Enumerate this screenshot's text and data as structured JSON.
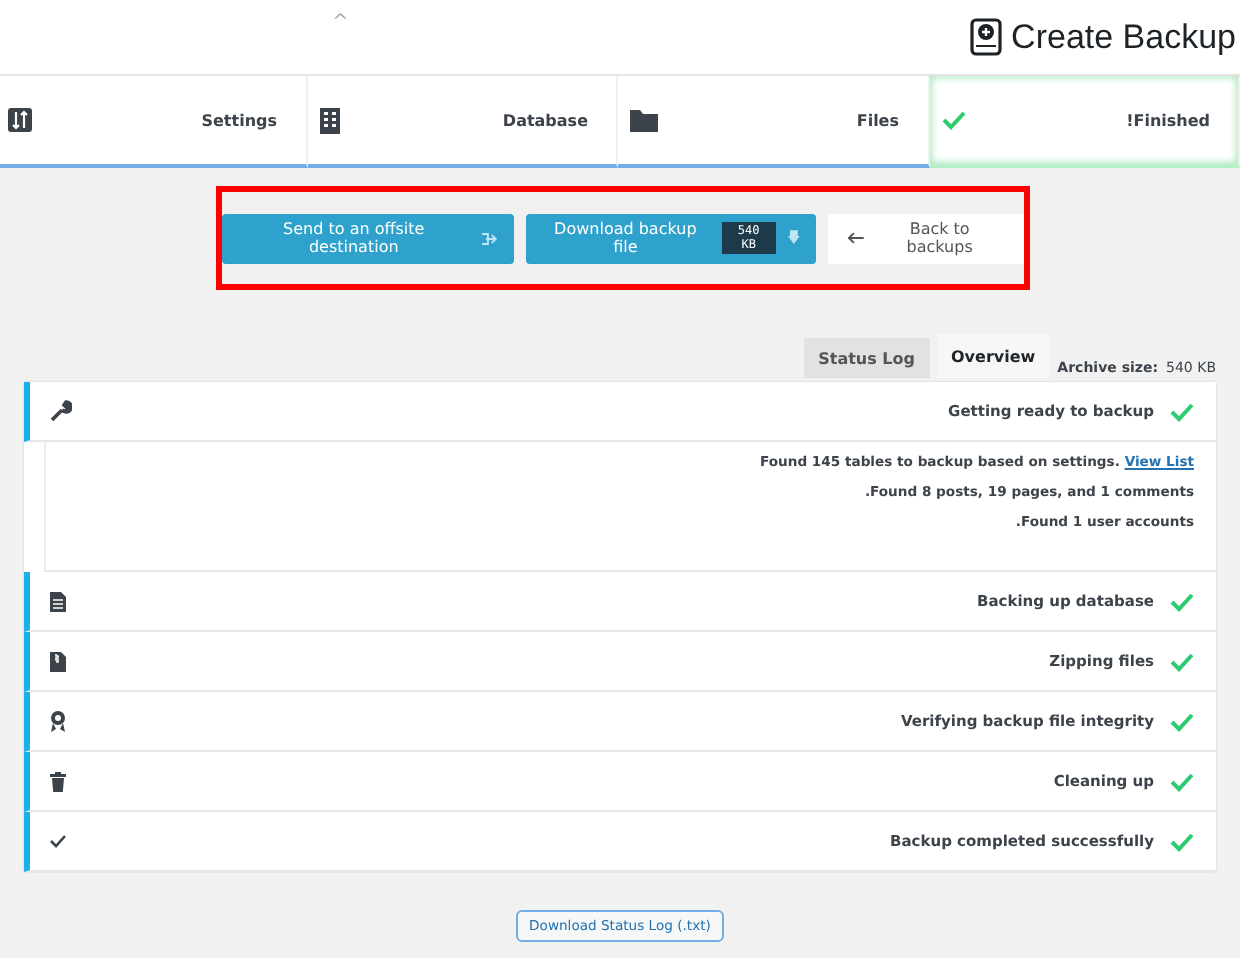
{
  "header": {
    "collapse_glyph": "^",
    "title": "Create Backup"
  },
  "steps": [
    {
      "label": "Settings",
      "selected": false
    },
    {
      "label": "Database",
      "selected": false
    },
    {
      "label": "Files",
      "selected": false
    },
    {
      "label": "!Finished",
      "selected": true
    }
  ],
  "actions": {
    "offsite": "Send to an offsite destination",
    "download": "Download backup file",
    "download_size": "540 KB",
    "back": "Back to backups"
  },
  "tabs": [
    {
      "label": "Status Log",
      "selected": false
    },
    {
      "label": "Overview",
      "selected": true
    }
  ],
  "archive_size": {
    "label": "Archive size:",
    "value": "540 KB"
  },
  "log": [
    {
      "text": "Getting ready to backup",
      "done": true,
      "details": [
        {
          "text": "Found 145 tables to backup based on settings.",
          "link": "View List"
        },
        {
          "text": ".Found 8 posts, 19 pages, and 1 comments"
        },
        {
          "text": ".Found 1 user accounts"
        }
      ]
    },
    {
      "text": "Backing up database",
      "done": true
    },
    {
      "text": "Zipping files",
      "done": true
    },
    {
      "text": "Verifying backup file integrity",
      "done": true
    },
    {
      "text": "Cleaning up",
      "done": true
    },
    {
      "text": "Backup completed successfully",
      "done": true
    }
  ],
  "download_log": "Download Status Log (.txt)"
}
